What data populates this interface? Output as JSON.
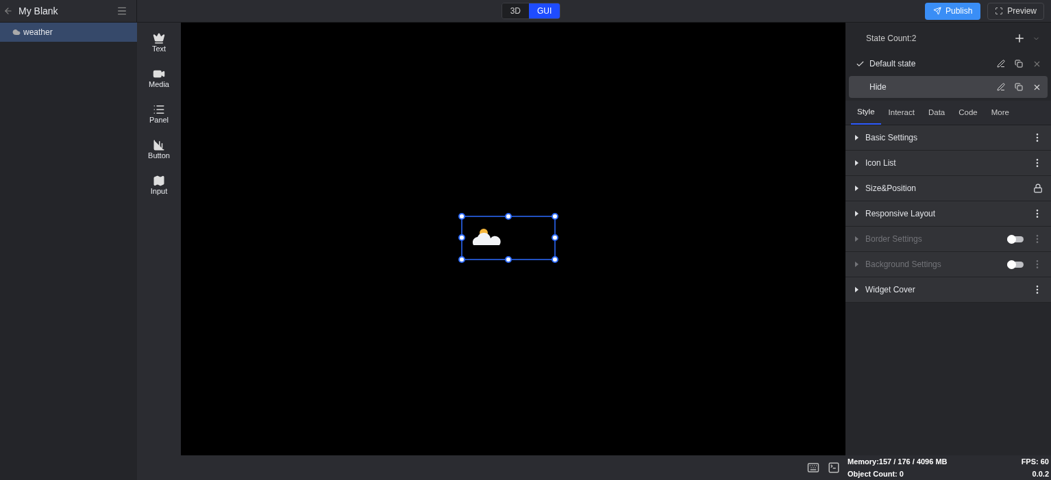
{
  "project": {
    "title": "My Blank"
  },
  "layers": [
    {
      "label": "weather",
      "selected": true
    }
  ],
  "mode_toggle": [
    {
      "label": "3D",
      "selected": false
    },
    {
      "label": "GUI",
      "selected": true
    }
  ],
  "actions": {
    "publish": "Publish",
    "preview": "Preview"
  },
  "toolbox": [
    {
      "label": "Text",
      "kind": "text"
    },
    {
      "label": "Media",
      "kind": "media"
    },
    {
      "label": "Panel",
      "kind": "panel"
    },
    {
      "label": "Button",
      "kind": "button"
    },
    {
      "label": "Input",
      "kind": "input"
    }
  ],
  "states": {
    "count_label": "State Count:2",
    "items": [
      {
        "label": "Default state",
        "checked": true,
        "highlighted": false
      },
      {
        "label": "Hide",
        "checked": false,
        "highlighted": true
      }
    ]
  },
  "tabs": [
    {
      "label": "Style",
      "selected": true
    },
    {
      "label": "Interact",
      "selected": false
    },
    {
      "label": "Data",
      "selected": false
    },
    {
      "label": "Code",
      "selected": false
    },
    {
      "label": "More",
      "selected": false
    }
  ],
  "sections": [
    {
      "label": "Basic Settings",
      "kind": "menu",
      "disabled": false
    },
    {
      "label": "Icon List",
      "kind": "menu",
      "disabled": false
    },
    {
      "label": "Size&Position",
      "kind": "lock",
      "disabled": false
    },
    {
      "label": "Responsive Layout",
      "kind": "menu",
      "disabled": false
    },
    {
      "label": "Border Settings",
      "kind": "toggle",
      "disabled": true,
      "on": false
    },
    {
      "label": "Background Settings",
      "kind": "toggle",
      "disabled": true,
      "on": false
    },
    {
      "label": "Widget Cover",
      "kind": "menu",
      "disabled": false
    }
  ],
  "status": {
    "memory": "Memory:157 / 176 / 4096 MB",
    "fps": "FPS: 60",
    "objects": "Object Count: 0",
    "version": "0.0.2"
  }
}
